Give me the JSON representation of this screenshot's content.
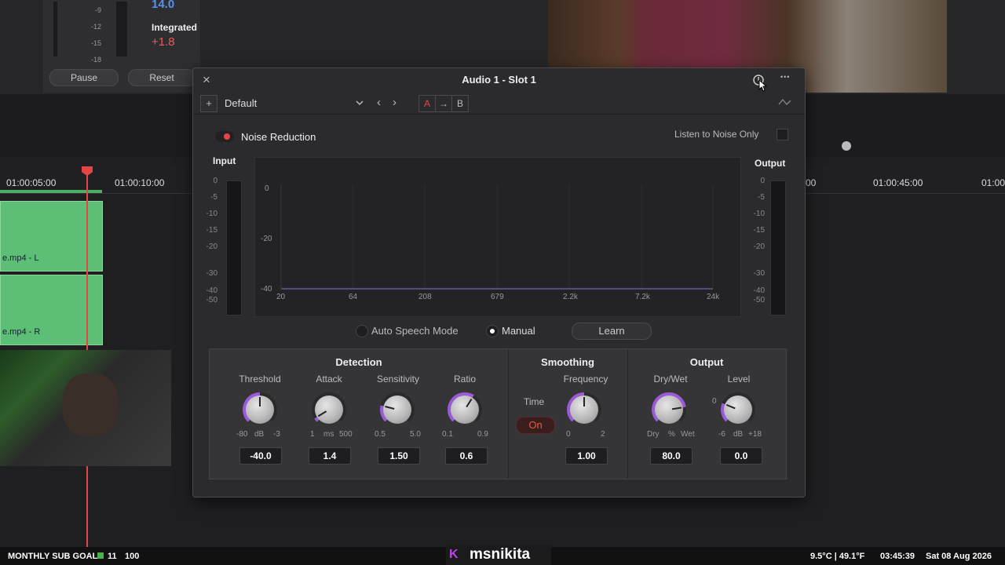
{
  "background": {
    "loudness_scale": [
      "-9",
      "-12",
      "-15",
      "-18"
    ],
    "short_term_value": "14.0",
    "integrated_label": "Integrated",
    "integrated_value": "+1.8",
    "pause_label": "Pause",
    "reset_label": "Reset",
    "ruler_labels": [
      "01:00:05:00",
      "01:00:10:00",
      "00",
      "01:00:45:00",
      "01:00"
    ],
    "clips": [
      "e.mp4 - L",
      "e.mp4 - R"
    ]
  },
  "window": {
    "title": "Audio 1 - Slot 1",
    "close_glyph": "×",
    "more_glyph": "•••",
    "add_glyph": "+",
    "preset_value": "Default",
    "prev_glyph": "‹",
    "next_glyph": "›",
    "ab_a": "A",
    "ab_arrow": "→",
    "ab_b": "B"
  },
  "plugin": {
    "noise_reduction_label": "Noise Reduction",
    "listen_label": "Listen to Noise Only",
    "input_label": "Input",
    "output_label": "Output",
    "meter_scale": [
      "0",
      "-5",
      "-10",
      "-15",
      "-20",
      "-30",
      "-40",
      "-50"
    ],
    "graph_y_labels": [
      "0",
      "-20",
      "-40"
    ],
    "graph_x_labels": [
      "20",
      "64",
      "208",
      "679",
      "2.2k",
      "7.2k",
      "24k"
    ],
    "auto_speech_label": "Auto Speech Mode",
    "manual_label": "Manual",
    "learn_label": "Learn"
  },
  "detection": {
    "title": "Detection",
    "threshold": {
      "label": "Threshold",
      "min": "-80",
      "unit": "dB",
      "max": "-3",
      "value": "-40.0",
      "level": 0.5
    },
    "attack": {
      "label": "Attack",
      "min": "1",
      "unit": "ms",
      "max": "500",
      "value": "1.4",
      "level": 0.05
    },
    "sensitivity": {
      "label": "Sensitivity",
      "min": "0.5",
      "unit": "",
      "max": "5.0",
      "value": "1.50",
      "level": 0.22
    },
    "ratio": {
      "label": "Ratio",
      "min": "0.1",
      "unit": "",
      "max": "0.9",
      "value": "0.6",
      "level": 0.62
    }
  },
  "smoothing": {
    "title": "Smoothing",
    "time_label": "Time",
    "time_state": "On",
    "frequency": {
      "label": "Frequency",
      "min": "0",
      "unit": "",
      "max": "2",
      "value": "1.00",
      "level": 0.5
    }
  },
  "output": {
    "title": "Output",
    "drywet": {
      "label": "Dry/Wet",
      "min": "Dry",
      "unit": "%",
      "max": "Wet",
      "value": "80.0",
      "level": 0.8
    },
    "level": {
      "label": "Level",
      "zero": "0",
      "min": "-6",
      "unit": "dB",
      "max": "+18",
      "value": "0.0",
      "level": 0.25
    }
  },
  "status": {
    "goal_label": "MONTHLY SUB GOAL",
    "goal_current": "11",
    "goal_target": "100",
    "channel": "msnikita",
    "weather": "9.5°C | 49.1°F",
    "time": "03:45:39",
    "date": "Sat 08 Aug 2026"
  },
  "colors": {
    "accent_red": "#e64545",
    "knob_ring": "#9c5bd6",
    "clip_green": "#5cbf75"
  }
}
